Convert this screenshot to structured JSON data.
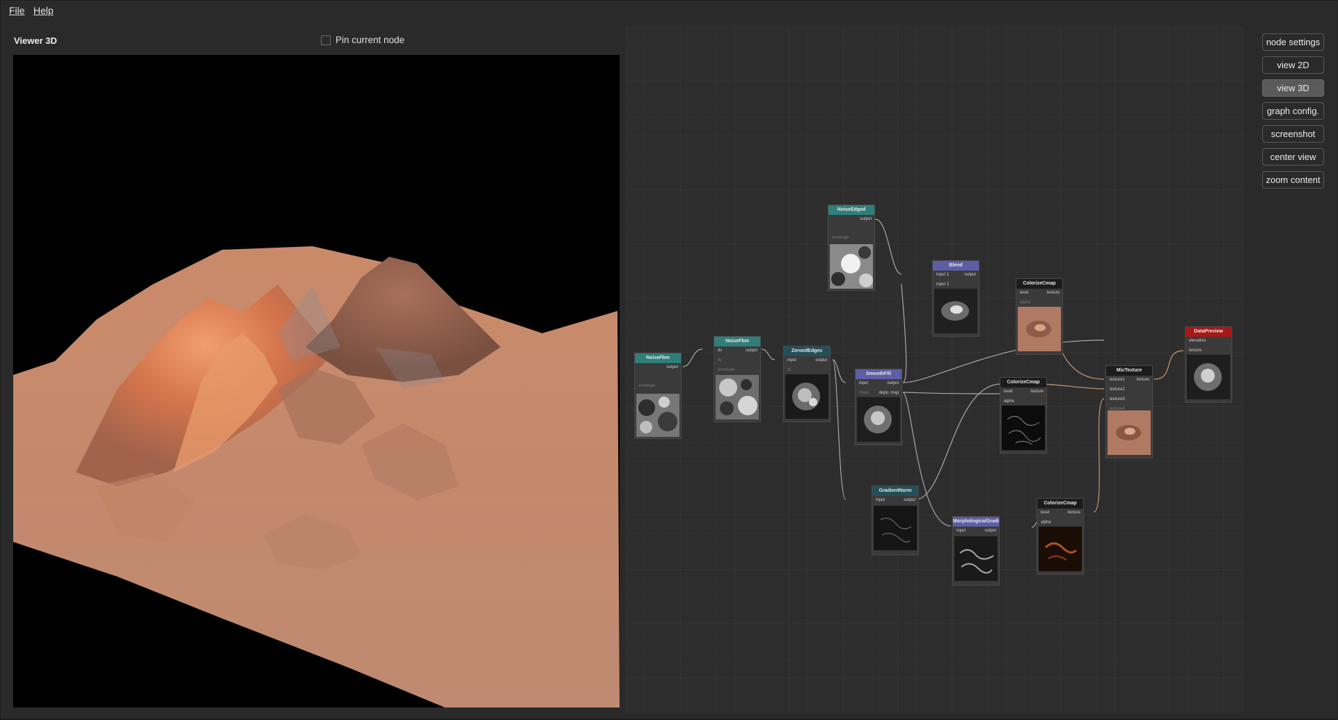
{
  "menu": {
    "items": [
      {
        "label": "File"
      },
      {
        "label": "Help"
      }
    ]
  },
  "viewer": {
    "title": "Viewer 3D",
    "pin_label": "Pin current node",
    "pin_checked": false
  },
  "sidebar": {
    "buttons": [
      {
        "label": "node settings",
        "active": false
      },
      {
        "label": "view 2D",
        "active": false
      },
      {
        "label": "view 3D",
        "active": true
      },
      {
        "label": "graph config.",
        "active": false
      },
      {
        "label": "screenshot",
        "active": false
      },
      {
        "label": "center view",
        "active": false
      },
      {
        "label": "zoom content",
        "active": false
      }
    ]
  },
  "graph": {
    "nodes": [
      {
        "title": "NoiseFbm",
        "inputs": [
          "",
          "",
          "",
          "envelope"
        ],
        "outputs": [
          "output"
        ],
        "color": "#2e7f7a"
      },
      {
        "title": "NoiseFbm",
        "inputs": [
          "dx",
          "dy",
          "envelope"
        ],
        "outputs": [
          "output"
        ],
        "color": "#2e7f7a"
      },
      {
        "title": "ZeroedEdges",
        "inputs": [
          "input",
          "dr"
        ],
        "outputs": [
          "output"
        ],
        "color": "#254f58"
      },
      {
        "title": "NoiseEdged",
        "inputs": [
          "",
          "",
          "envelope"
        ],
        "outputs": [
          "output"
        ],
        "color": "#2e7f7a"
      },
      {
        "title": "Blend",
        "inputs": [
          "input 1",
          "input 2"
        ],
        "outputs": [
          "output"
        ],
        "color": "#5c5ea6"
      },
      {
        "title": "SmoothFill",
        "inputs": [
          "input",
          "mask"
        ],
        "outputs": [
          "output",
          "depo. map"
        ],
        "color": "#5c5ea6"
      },
      {
        "title": "ColorizeCmap",
        "inputs": [
          "level",
          "alpha"
        ],
        "outputs": [
          "texture"
        ],
        "color": "#1c1c1c"
      },
      {
        "title": "ColorizeCmap",
        "inputs": [
          "level",
          "alpha"
        ],
        "outputs": [
          "texture"
        ],
        "color": "#1c1c1c"
      },
      {
        "title": "GradientNorm",
        "inputs": [
          "input"
        ],
        "outputs": [
          "output"
        ],
        "color": "#254f58"
      },
      {
        "title": "MorphologicalGradient",
        "inputs": [
          "input"
        ],
        "outputs": [
          "output"
        ],
        "color": "#5c5ea6"
      },
      {
        "title": "ColorizeCmap",
        "inputs": [
          "level",
          "alpha"
        ],
        "outputs": [
          "texture"
        ],
        "color": "#1c1c1c"
      },
      {
        "title": "MixTexture",
        "inputs": [
          "texture1",
          "texture2",
          "texture3",
          "texture4"
        ],
        "outputs": [
          "texture"
        ],
        "color": "#1c1c1c"
      },
      {
        "title": "DataPreview",
        "inputs": [
          "elevation",
          "texture"
        ],
        "outputs": [],
        "color": "#a81616"
      }
    ]
  }
}
